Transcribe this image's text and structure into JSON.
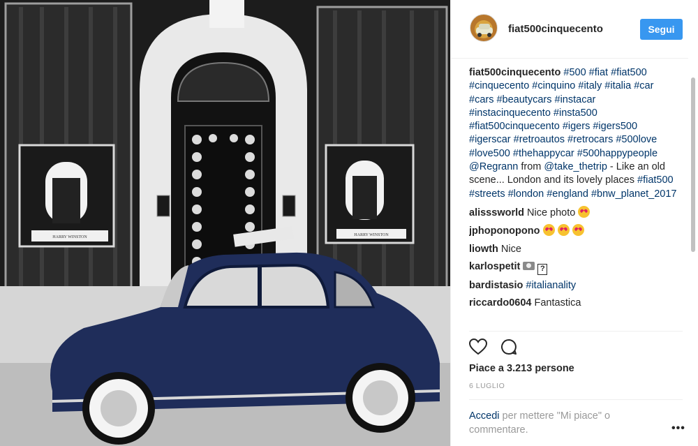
{
  "post": {
    "author": "fiat500cinquecento",
    "follow_label": "Segui",
    "caption_user": "fiat500cinquecento",
    "caption_tags": "#500 #fiat #fiat500 #cinquecento #cinquino #italy #italia #car #cars #beautycars #instacar #instacinquecento #insta500 #fiat500cinquecento #igers #igers500 #igerscar #retroautos #retrocars #500love #love500 #thehappycar #500happypeople",
    "caption_mention": "@Regrann",
    "caption_from": " from ",
    "caption_mention2": "@take_thetrip",
    "caption_text": " - Like an old scene... London and its lovely places ",
    "caption_tags2": "#fiat500 #streets #london #england #bnw_planet_2017",
    "likes": "Piace a 3.213 persone",
    "date": "6 LUGLIO",
    "storefront_sign_left": "HARRY WINSTON",
    "storefront_sign_right": "HARRY WINSTON"
  },
  "comments": [
    {
      "user": "alisssworld",
      "text": "Nice photo",
      "emoji": 1
    },
    {
      "user": "jphoponopono",
      "text": "",
      "emoji": 3
    },
    {
      "user": "liowth",
      "text": "Nice",
      "emoji": 0
    },
    {
      "user": "karlospetit",
      "text": "",
      "emoji": 0
    },
    {
      "user": "bardistasio",
      "text": "#italianality",
      "emoji": 0
    },
    {
      "user": "riccardo0604",
      "text": "Fantastica",
      "emoji": 0
    }
  ],
  "login": {
    "link": "Accedi",
    "text": " per mettere \"Mi piace\" o commentare."
  },
  "more_label": "•••",
  "icons": [
    "heart-icon",
    "comment-bubble-icon",
    "camera-icon",
    "heart-eyes-emoji",
    "more-options-icon"
  ],
  "colors": {
    "follow_button": "#3897f0",
    "hashtag": "#003569",
    "muted": "#999999",
    "car": "#1f2d5a"
  }
}
